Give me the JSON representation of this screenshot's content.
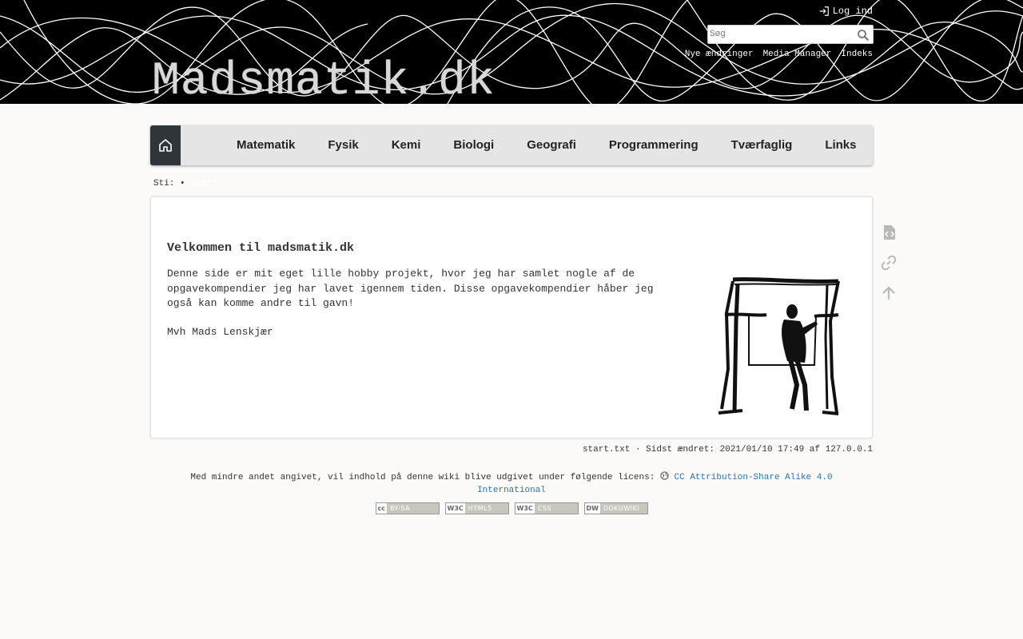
{
  "header": {
    "site_title": "Madsmatik.dk",
    "login_label": "Log ind",
    "search_placeholder": "Søg",
    "tools": [
      "Nye ændringer",
      "Media Manager",
      "Indeks"
    ]
  },
  "nav": {
    "items": [
      "Matematik",
      "Fysik",
      "Kemi",
      "Biologi",
      "Geografi",
      "Programmering",
      "Tværfaglig",
      "Links"
    ]
  },
  "breadcrumb": {
    "label": "Sti:",
    "separator": "•",
    "current": "start"
  },
  "content": {
    "heading": "Velkommen til madsmatik.dk",
    "paragraph": "Denne side er mit eget lille hobby projekt, hvor jeg har samlet nogle af de opgavekompendier jeg har lavet igennem tiden. Disse opgavekompendier håber jeg også kan komme andre til gavn!",
    "signature": "Mvh Mads Lenskjær"
  },
  "docinfo": "start.txt · Sidst ændret: 2021/01/10 17:49 af 127.0.0.1",
  "license": {
    "text": "Med mindre andet angivet, vil indhold på denne wiki blive udgivet under følgende licens:",
    "link_line1": "CC Attribution-Share Alike 4.0",
    "link_line2": "International"
  },
  "badges": [
    {
      "left": "cc",
      "right": "BY-SA"
    },
    {
      "left": "W3C",
      "right": "HTML5"
    },
    {
      "left": "W3C",
      "right": "CSS"
    },
    {
      "left": "DW",
      "right": "DOKUWIKI"
    }
  ],
  "colors": {
    "header_bg": "#000000",
    "nav_bg": "#e5e5e5",
    "home_bg": "#30353a",
    "link": "#2b73b7",
    "page_bg": "#fbfaf9"
  }
}
